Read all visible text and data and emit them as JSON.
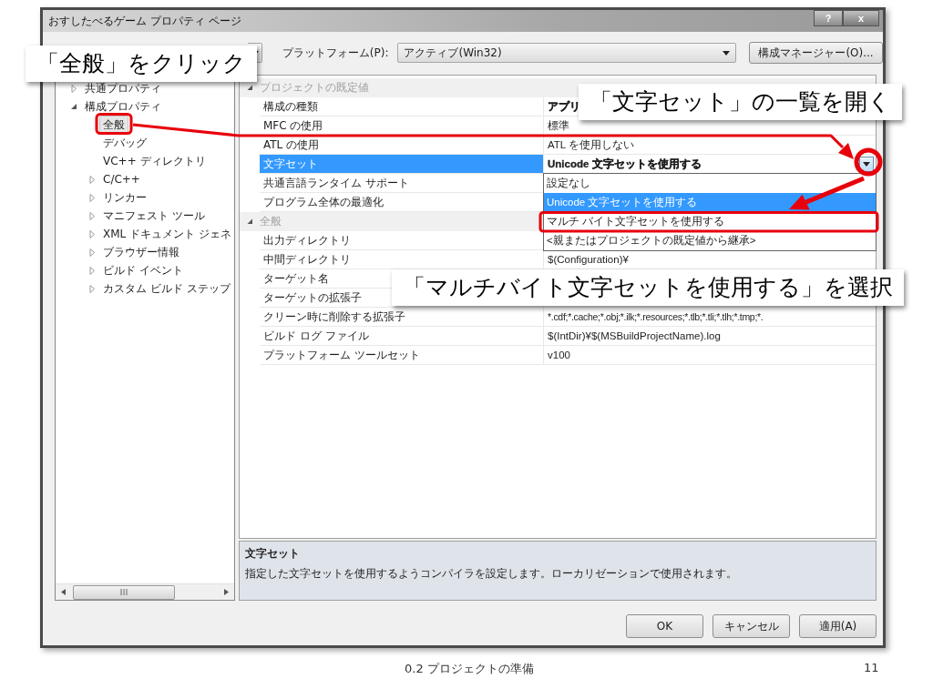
{
  "window": {
    "title": "おすしたべるゲーム プロパティ ページ",
    "help_button": "?",
    "close_button": "x"
  },
  "toolbar": {
    "platform_label": "プラットフォーム(P):",
    "platform_value": "アクティブ(Win32)",
    "config_manager_button": "構成マネージャー(O)..."
  },
  "tree": [
    {
      "label": "共通プロパティ",
      "kind": "node",
      "expanded": false,
      "selected": false
    },
    {
      "label": "構成プロパティ",
      "kind": "node",
      "expanded": true,
      "selected": false,
      "children": [
        {
          "label": "全般",
          "kind": "leaf",
          "selected": true
        },
        {
          "label": "デバッグ",
          "kind": "leaf",
          "selected": false
        },
        {
          "label": "VC++ ディレクトリ",
          "kind": "leaf",
          "selected": false
        },
        {
          "label": "C/C++",
          "kind": "node",
          "expanded": false,
          "selected": false
        },
        {
          "label": "リンカー",
          "kind": "node",
          "expanded": false,
          "selected": false
        },
        {
          "label": "マニフェスト ツール",
          "kind": "node",
          "expanded": false,
          "selected": false
        },
        {
          "label": "XML ドキュメント ジェネ",
          "kind": "node",
          "expanded": false,
          "selected": false
        },
        {
          "label": "ブラウザー情報",
          "kind": "node",
          "expanded": false,
          "selected": false
        },
        {
          "label": "ビルド イベント",
          "kind": "node",
          "expanded": false,
          "selected": false
        },
        {
          "label": "カスタム ビルド ステップ",
          "kind": "node",
          "expanded": false,
          "selected": false
        }
      ]
    }
  ],
  "property_grid": {
    "categories": [
      {
        "title": "プロジェクトの既定値",
        "expanded": true,
        "rows": [
          {
            "name": "構成の種類",
            "value": "アプリ",
            "selected": false,
            "modified": true
          },
          {
            "name": "MFC の使用",
            "value": "標準",
            "selected": false,
            "modified": false
          },
          {
            "name": "ATL の使用",
            "value": "ATL を使用しない",
            "selected": false,
            "modified": false
          },
          {
            "name": "文字セット",
            "value": "Unicode 文字セットを使用する",
            "selected": true,
            "modified": true
          },
          {
            "name": "共通言語ランタイム サポート",
            "selected": false
          },
          {
            "name": "プログラム全体の最適化",
            "selected": false
          }
        ]
      },
      {
        "title": "全般",
        "expanded": true,
        "rows": [
          {
            "name": "出力ディレクトリ",
            "selected": false
          },
          {
            "name": "中間ディレクトリ",
            "value": "$(Configuration)¥",
            "selected": false,
            "modified": false
          },
          {
            "name": "ターゲット名",
            "selected": false
          },
          {
            "name": "ターゲットの拡張子",
            "selected": false
          },
          {
            "name": "クリーン時に削除する拡張子",
            "value": "*.cdf;*.cache;*.obj;*.ilk;*.resources;*.tlb;*.tli;*.tlh;*.tmp;*.",
            "selected": false,
            "modified": false
          },
          {
            "name": "ビルド ログ ファイル",
            "value": "$(IntDir)¥$(MSBuildProjectName).log",
            "selected": false,
            "modified": false
          },
          {
            "name": "プラットフォーム ツールセット",
            "value": "v100",
            "selected": false,
            "modified": false
          }
        ]
      }
    ],
    "dropdown_options": [
      {
        "label": "設定なし",
        "selected": false
      },
      {
        "label": "Unicode 文字セットを使用する",
        "selected": true
      },
      {
        "label": "マルチ バイト文字セットを使用する",
        "selected": false
      },
      {
        "label": "<親またはプロジェクトの既定値から継承>",
        "selected": false
      }
    ]
  },
  "description": {
    "title": "文字セット",
    "text": "指定した文字セットを使用するようコンパイラを設定します。ローカリゼーションで使用されます。"
  },
  "buttons": [
    "OK",
    "キャンセル",
    "適用(A)"
  ],
  "callouts": [
    "「全般」をクリック",
    "「文字セット」の一覧を開く",
    "「マルチバイト文字セットを使用する」を選択"
  ],
  "footer": {
    "section": "0.2 プロジェクトの準備",
    "page": "11"
  }
}
